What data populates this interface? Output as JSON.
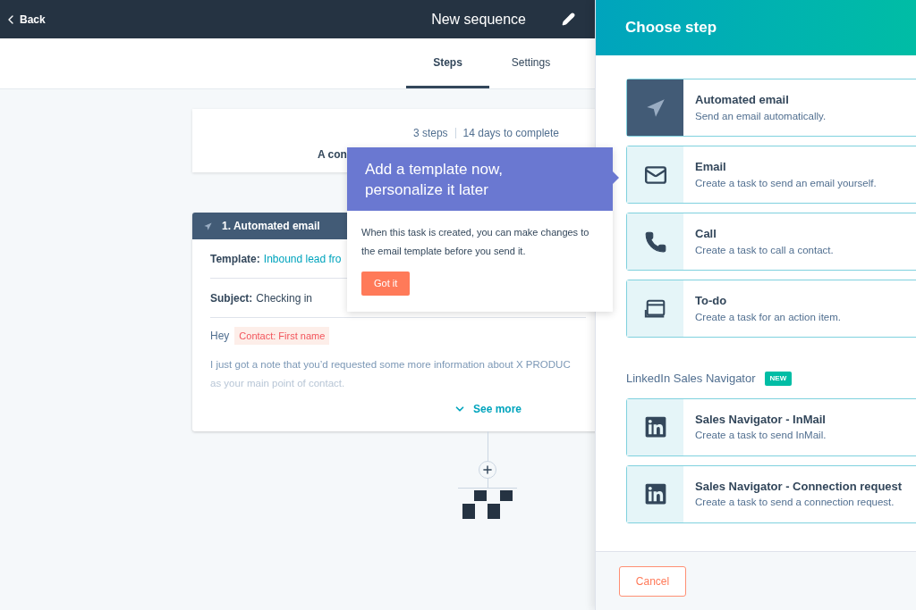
{
  "header": {
    "back": "Back",
    "title": "New sequence"
  },
  "tabs": [
    {
      "label": "Steps",
      "selected": true
    },
    {
      "label": "Settings",
      "selected": false
    }
  ],
  "summary": {
    "steps": "3 steps",
    "duration": "14 days to complete",
    "description": "A con"
  },
  "step_card": {
    "title": "1. Automated email",
    "template_label": "Template:",
    "template_value": "Inbound lead fro",
    "subject_label": "Subject:",
    "subject_value": "Checking in",
    "greeting": "Hey",
    "token": "Contact: First name",
    "body": "I just got a note that you’d requested some more information about X PRODUC",
    "body_2": "as your main point of contact.",
    "see_more": "See more"
  },
  "popover": {
    "title": "Add a template now, personalize it later",
    "text": "When this task is created, you can make changes to the email template before you send it.",
    "button": "Got it"
  },
  "panel": {
    "title": "Choose step",
    "options": [
      {
        "kind": "automated",
        "title": "Automated email",
        "description": "Send an email automatically.",
        "selected": true
      },
      {
        "kind": "email",
        "title": "Email",
        "description": "Create a task to send an email yourself.",
        "selected": false
      },
      {
        "kind": "call",
        "title": "Call",
        "description": "Create a task to call a contact.",
        "selected": false
      },
      {
        "kind": "todo",
        "title": "To-do",
        "description": "Create a task for an action item.",
        "selected": false
      }
    ],
    "section": {
      "title": "LinkedIn Sales Navigator",
      "badge": "NEW",
      "options": [
        {
          "kind": "linkedin",
          "title": "Sales Navigator - InMail",
          "description": "Create a task to send InMail.",
          "selected": false
        },
        {
          "kind": "linkedin",
          "title": "Sales Navigator - Connection request",
          "description": "Create a task to send a connection request.",
          "selected": false
        }
      ]
    },
    "cancel": "Cancel"
  }
}
